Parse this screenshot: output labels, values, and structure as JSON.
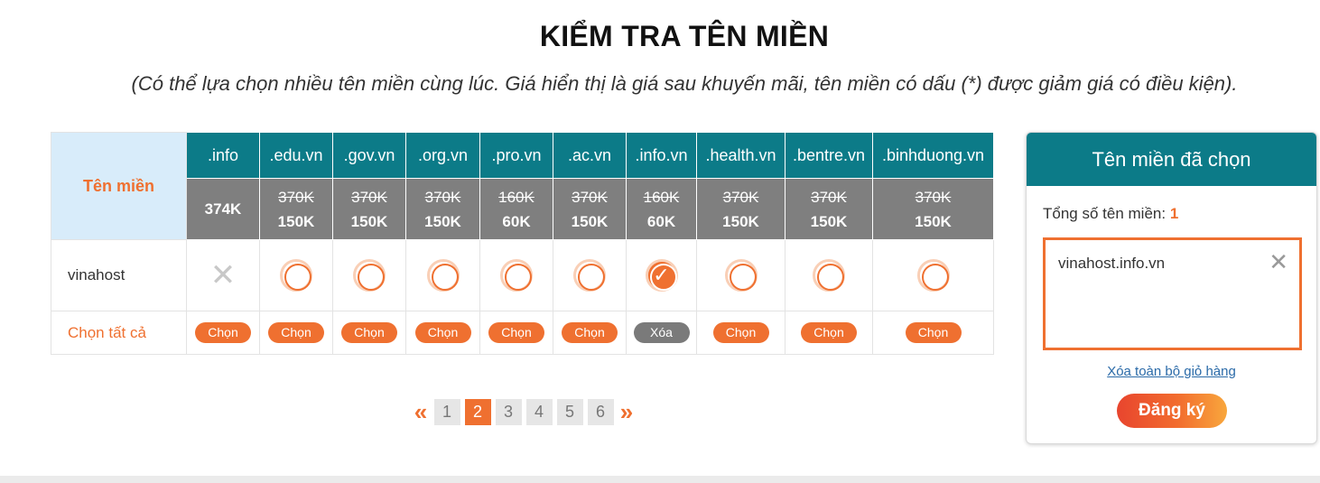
{
  "title": "KIỂM TRA TÊN MIỀN",
  "subtitle": "(Có thể lựa chọn nhiều tên miền cùng lúc. Giá hiển thị là giá sau khuyến mãi, tên miền có dấu (*) được giảm giá có điều kiện).",
  "table": {
    "header_label": "Tên miền",
    "extensions": [
      {
        "name": ".info",
        "old_price": "",
        "price": "374K",
        "status": "unavailable",
        "action": "Chọn"
      },
      {
        "name": ".edu.vn",
        "old_price": "370K",
        "price": "150K",
        "status": "available",
        "action": "Chọn"
      },
      {
        "name": ".gov.vn",
        "old_price": "370K",
        "price": "150K",
        "status": "available",
        "action": "Chọn"
      },
      {
        "name": ".org.vn",
        "old_price": "370K",
        "price": "150K",
        "status": "available",
        "action": "Chọn"
      },
      {
        "name": ".pro.vn",
        "old_price": "160K",
        "price": "60K",
        "status": "available",
        "action": "Chọn"
      },
      {
        "name": ".ac.vn",
        "old_price": "370K",
        "price": "150K",
        "status": "available",
        "action": "Chọn"
      },
      {
        "name": ".info.vn",
        "old_price": "160K",
        "price": "60K",
        "status": "selected",
        "action": "Xóa"
      },
      {
        "name": ".health.vn",
        "old_price": "370K",
        "price": "150K",
        "status": "available",
        "action": "Chọn"
      },
      {
        "name": ".bentre.vn",
        "old_price": "370K",
        "price": "150K",
        "status": "available",
        "action": "Chọn"
      },
      {
        "name": ".binhduong.vn",
        "old_price": "370K",
        "price": "150K",
        "status": "available",
        "action": "Chọn"
      }
    ],
    "row_name": "vinahost",
    "select_all_label": "Chọn tất cả"
  },
  "pagination": {
    "prev": "«",
    "next": "»",
    "pages": [
      "1",
      "2",
      "3",
      "4",
      "5",
      "6"
    ],
    "current": "2"
  },
  "cart": {
    "title": "Tên miền đã chọn",
    "count_label": "Tổng số tên miền:",
    "count": "1",
    "items": [
      "vinahost.info.vn"
    ],
    "remove_icon": "close-icon",
    "clear_label": "Xóa toàn bộ giỏ hàng",
    "register_label": "Đăng ký"
  },
  "colors": {
    "accent": "#ef7030",
    "teal": "#0c7b88",
    "price_bg": "#7f7f7f",
    "header_bg": "#d8ecfa"
  }
}
